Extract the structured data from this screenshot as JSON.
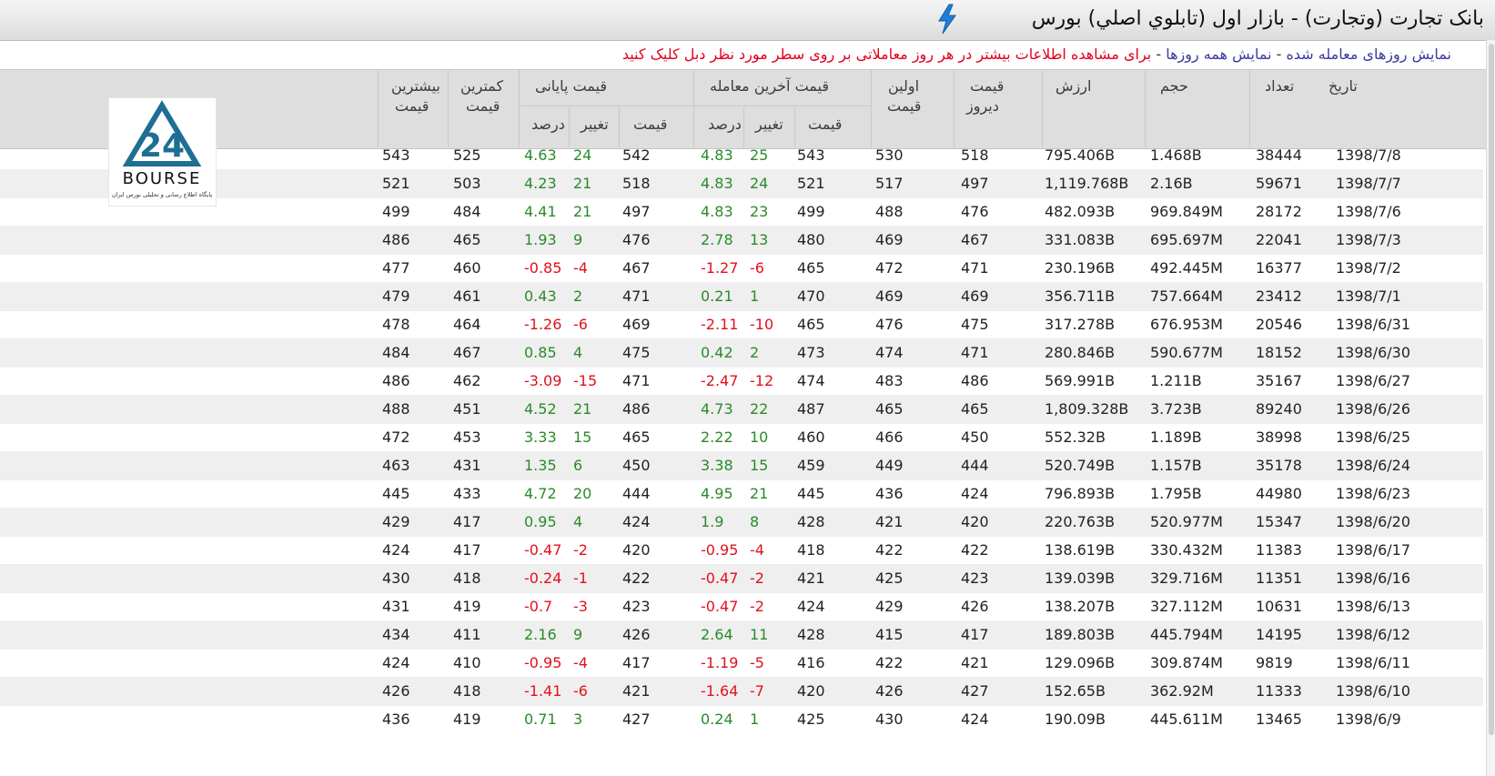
{
  "title": "بانک تجارت (وتجارت) - بازار اول (تابلوي اصلي) بورس",
  "title_icon": "lightning-bolt-icon",
  "info": {
    "link_traded": "نمایش روزهای معامله شده",
    "sep1": " - ",
    "link_all": "نمایش همه روزها",
    "sep2": " - ",
    "note": "برای مشاهده اطلاعات بیشتر در هر روز معاملاتی بر روی سطر مورد نظر دبل کلیک کنید"
  },
  "logo": {
    "text": "BOURSE",
    "subtitle": "پایگاه اطلاع رسانی و تحلیلی بورس ایران",
    "mark": "24"
  },
  "headers": {
    "date": "تاریخ",
    "count": "تعداد",
    "volume": "حجم",
    "value": "ارزش",
    "yesterday": [
      "قیمت",
      "دیروز"
    ],
    "first": [
      "اولین",
      "قیمت"
    ],
    "last_trade_group": "قیمت آخرین معامله",
    "closing_group": "قیمت پایانی",
    "price": "قیمت",
    "change": "تغییر",
    "percent": "درصد",
    "low": [
      "کمترین",
      "قیمت"
    ],
    "high": [
      "بیشترین",
      "قیمت"
    ]
  },
  "colors": {
    "positive": "#2a8a2a",
    "negative": "#e2101c",
    "note": "#e0001b",
    "link": "#3a3aa0"
  },
  "rows": [
    {
      "date": "1398/7/8",
      "count": "38444",
      "volume": "1.468B",
      "value": "795.406B",
      "yesterday": "518",
      "first": "530",
      "last_price": "543",
      "last_change": "25",
      "last_pct": "4.83",
      "close_price": "542",
      "close_change": "24",
      "close_pct": "4.63",
      "low": "525",
      "high": "543"
    },
    {
      "date": "1398/7/7",
      "count": "59671",
      "volume": "2.16B",
      "value": "1,119.768B",
      "yesterday": "497",
      "first": "517",
      "last_price": "521",
      "last_change": "24",
      "last_pct": "4.83",
      "close_price": "518",
      "close_change": "21",
      "close_pct": "4.23",
      "low": "503",
      "high": "521"
    },
    {
      "date": "1398/7/6",
      "count": "28172",
      "volume": "969.849M",
      "value": "482.093B",
      "yesterday": "476",
      "first": "488",
      "last_price": "499",
      "last_change": "23",
      "last_pct": "4.83",
      "close_price": "497",
      "close_change": "21",
      "close_pct": "4.41",
      "low": "484",
      "high": "499"
    },
    {
      "date": "1398/7/3",
      "count": "22041",
      "volume": "695.697M",
      "value": "331.083B",
      "yesterday": "467",
      "first": "469",
      "last_price": "480",
      "last_change": "13",
      "last_pct": "2.78",
      "close_price": "476",
      "close_change": "9",
      "close_pct": "1.93",
      "low": "465",
      "high": "486"
    },
    {
      "date": "1398/7/2",
      "count": "16377",
      "volume": "492.445M",
      "value": "230.196B",
      "yesterday": "471",
      "first": "472",
      "last_price": "465",
      "last_change": "-6",
      "last_pct": "-1.27",
      "close_price": "467",
      "close_change": "-4",
      "close_pct": "-0.85",
      "low": "460",
      "high": "477"
    },
    {
      "date": "1398/7/1",
      "count": "23412",
      "volume": "757.664M",
      "value": "356.711B",
      "yesterday": "469",
      "first": "469",
      "last_price": "470",
      "last_change": "1",
      "last_pct": "0.21",
      "close_price": "471",
      "close_change": "2",
      "close_pct": "0.43",
      "low": "461",
      "high": "479"
    },
    {
      "date": "1398/6/31",
      "count": "20546",
      "volume": "676.953M",
      "value": "317.278B",
      "yesterday": "475",
      "first": "476",
      "last_price": "465",
      "last_change": "-10",
      "last_pct": "-2.11",
      "close_price": "469",
      "close_change": "-6",
      "close_pct": "-1.26",
      "low": "464",
      "high": "478"
    },
    {
      "date": "1398/6/30",
      "count": "18152",
      "volume": "590.677M",
      "value": "280.846B",
      "yesterday": "471",
      "first": "474",
      "last_price": "473",
      "last_change": "2",
      "last_pct": "0.42",
      "close_price": "475",
      "close_change": "4",
      "close_pct": "0.85",
      "low": "467",
      "high": "484"
    },
    {
      "date": "1398/6/27",
      "count": "35167",
      "volume": "1.211B",
      "value": "569.991B",
      "yesterday": "486",
      "first": "483",
      "last_price": "474",
      "last_change": "-12",
      "last_pct": "-2.47",
      "close_price": "471",
      "close_change": "-15",
      "close_pct": "-3.09",
      "low": "462",
      "high": "486"
    },
    {
      "date": "1398/6/26",
      "count": "89240",
      "volume": "3.723B",
      "value": "1,809.328B",
      "yesterday": "465",
      "first": "465",
      "last_price": "487",
      "last_change": "22",
      "last_pct": "4.73",
      "close_price": "486",
      "close_change": "21",
      "close_pct": "4.52",
      "low": "451",
      "high": "488"
    },
    {
      "date": "1398/6/25",
      "count": "38998",
      "volume": "1.189B",
      "value": "552.32B",
      "yesterday": "450",
      "first": "466",
      "last_price": "460",
      "last_change": "10",
      "last_pct": "2.22",
      "close_price": "465",
      "close_change": "15",
      "close_pct": "3.33",
      "low": "453",
      "high": "472"
    },
    {
      "date": "1398/6/24",
      "count": "35178",
      "volume": "1.157B",
      "value": "520.749B",
      "yesterday": "444",
      "first": "449",
      "last_price": "459",
      "last_change": "15",
      "last_pct": "3.38",
      "close_price": "450",
      "close_change": "6",
      "close_pct": "1.35",
      "low": "431",
      "high": "463"
    },
    {
      "date": "1398/6/23",
      "count": "44980",
      "volume": "1.795B",
      "value": "796.893B",
      "yesterday": "424",
      "first": "436",
      "last_price": "445",
      "last_change": "21",
      "last_pct": "4.95",
      "close_price": "444",
      "close_change": "20",
      "close_pct": "4.72",
      "low": "433",
      "high": "445"
    },
    {
      "date": "1398/6/20",
      "count": "15347",
      "volume": "520.977M",
      "value": "220.763B",
      "yesterday": "420",
      "first": "421",
      "last_price": "428",
      "last_change": "8",
      "last_pct": "1.9",
      "close_price": "424",
      "close_change": "4",
      "close_pct": "0.95",
      "low": "417",
      "high": "429"
    },
    {
      "date": "1398/6/17",
      "count": "11383",
      "volume": "330.432M",
      "value": "138.619B",
      "yesterday": "422",
      "first": "422",
      "last_price": "418",
      "last_change": "-4",
      "last_pct": "-0.95",
      "close_price": "420",
      "close_change": "-2",
      "close_pct": "-0.47",
      "low": "417",
      "high": "424"
    },
    {
      "date": "1398/6/16",
      "count": "11351",
      "volume": "329.716M",
      "value": "139.039B",
      "yesterday": "423",
      "first": "425",
      "last_price": "421",
      "last_change": "-2",
      "last_pct": "-0.47",
      "close_price": "422",
      "close_change": "-1",
      "close_pct": "-0.24",
      "low": "418",
      "high": "430"
    },
    {
      "date": "1398/6/13",
      "count": "10631",
      "volume": "327.112M",
      "value": "138.207B",
      "yesterday": "426",
      "first": "429",
      "last_price": "424",
      "last_change": "-2",
      "last_pct": "-0.47",
      "close_price": "423",
      "close_change": "-3",
      "close_pct": "-0.7",
      "low": "419",
      "high": "431"
    },
    {
      "date": "1398/6/12",
      "count": "14195",
      "volume": "445.794M",
      "value": "189.803B",
      "yesterday": "417",
      "first": "415",
      "last_price": "428",
      "last_change": "11",
      "last_pct": "2.64",
      "close_price": "426",
      "close_change": "9",
      "close_pct": "2.16",
      "low": "411",
      "high": "434"
    },
    {
      "date": "1398/6/11",
      "count": "9819",
      "volume": "309.874M",
      "value": "129.096B",
      "yesterday": "421",
      "first": "422",
      "last_price": "416",
      "last_change": "-5",
      "last_pct": "-1.19",
      "close_price": "417",
      "close_change": "-4",
      "close_pct": "-0.95",
      "low": "410",
      "high": "424"
    },
    {
      "date": "1398/6/10",
      "count": "11333",
      "volume": "362.92M",
      "value": "152.65B",
      "yesterday": "427",
      "first": "426",
      "last_price": "420",
      "last_change": "-7",
      "last_pct": "-1.64",
      "close_price": "421",
      "close_change": "-6",
      "close_pct": "-1.41",
      "low": "418",
      "high": "426"
    },
    {
      "date": "1398/6/9",
      "count": "13465",
      "volume": "445.611M",
      "value": "190.09B",
      "yesterday": "424",
      "first": "430",
      "last_price": "425",
      "last_change": "1",
      "last_pct": "0.24",
      "close_price": "427",
      "close_change": "3",
      "close_pct": "0.71",
      "low": "419",
      "high": "436"
    }
  ]
}
